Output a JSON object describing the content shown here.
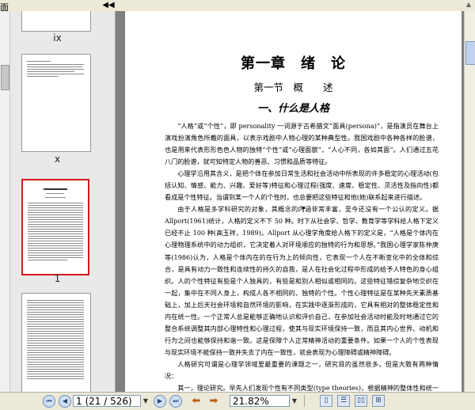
{
  "panel": {
    "title": "面",
    "collapse_glyph": "◀◀",
    "thumbnail_labels": [
      "ix",
      "x",
      "1"
    ]
  },
  "document": {
    "chapter_title": "第一章　绪　论",
    "section_title": "第一节　概　　述",
    "sub_title": "一、什么是人格",
    "paragraphs": [
      "“人格”或“个性”，即 personality 一词源于古希腊文“面具(persona)”，是指演员在舞台上演戏扮演角色所戴的面具，以表示戏剧中人物心理的某种典型性。我国戏剧中各种各样的脸谱，也是用来代表形形色色人物的独特“个性”或“心理面貌”，“人心不同，各如其面”。人们通过五花八门的脸谱，就可知特定人物的善恶、习惯和品质等特征。",
      "心理学沿用其含义，是把个体在参加日常生活和社会活动中所表现的许多稳定的心理活动(包括认知、情感、能力、兴趣、爱好等)特征和心理过程(强度、速度、稳定性、灵活性及指向性)都看成是个性特征。当谓到某一个人的个性时，也总要把这些特征和他(她)联系起来进行描述。",
      "由于人格是多学科研究的对象，其概念的内涵非常丰富，至今还没有一个公认的定义。据 Allport(1961)统计，人格的定义不下 50 种。时下从社会学、哲学、教育学等学科给人格下定义已经不止 100 种(高玉祥，1989)。Allport 从心理学角度给人格下的定义是，“人格是个体内在心理物理系统中的动力组织，它决定着人对环境顺应的独特的行为和思想。”我国心理学家陈仲庚等(1986)认为，人格是个体内在的在行为上的倾向性，它表现一个人在不断变化中的全体和综合，是具有动力一致性和连续性的持久的自我，是人在社会化过程中形成的给予人特色的身心组织。人的个性特征有些是个人独具的，有些是和别人相似或相同的。这些特征错综复杂地交织在一起，集中在不同人身上，构成人各不相同的、独特的个性。个性心理特征是在某种先天素质基础上，加上后天社会环境和自然环境的影响，在实践中逐渐形成的，它具有相对的整体稳定性和内在统一性。一个正常人总是能够正确地认识和评价自己，在参加社会活动时能及时地通过它的整合系统调整其内部心理特性和心理过程，使其与现实环境保持一致，而且其内心世界、动机和行为之间也能够保持和谐一致。这是保障个人正常精神活动的重要条件。如果一个人的个性表现与现实环境不能保持一致并失去了内在一致性，就会表现为心理障碍或精神障碍。",
      "人格研究可谓是心理学领域里最重要的课题之一，研究目的虽然很多，但是大致有两种情况：",
      "其一，理论研究。早先人们发现个性有不同类型(type theories)，根据精神的整体性和统一性可以把个体与另一个体加以区分；有些学者强调个性有不同的表现形式，而对个性的情况全面作出解释。"
    ]
  },
  "toolbar": {
    "page_field": "1 (21 / 526)",
    "zoom_field": "21.82%"
  },
  "colors": {
    "selected_thumb_border": "#d21b1b",
    "doc_background": "#808080",
    "toolbar_bg": "#ece9d8"
  }
}
